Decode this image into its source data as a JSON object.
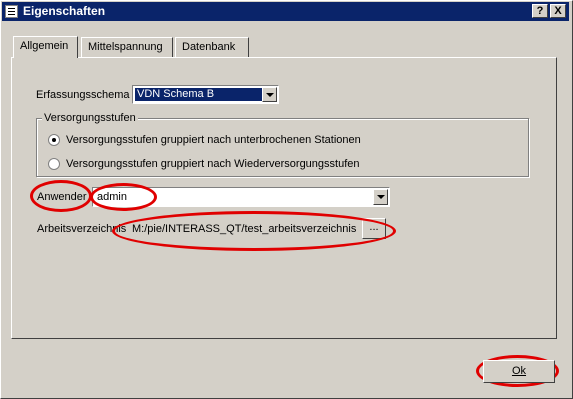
{
  "window": {
    "title": "Eigenschaften",
    "help_button": "?",
    "close_button": "X"
  },
  "tabs": [
    {
      "label": "Allgemein",
      "active": true
    },
    {
      "label": "Mittelspannung",
      "active": false
    },
    {
      "label": "Datenbank",
      "active": false
    }
  ],
  "form": {
    "erfassungsschema_label": "Erfassungsschema",
    "erfassungsschema_value": "VDN Schema B",
    "versorgungsstufen_group_title": "Versorgungsstufen",
    "radio_options": [
      {
        "label": "Versorgungsstufen gruppiert nach unterbrochenen Stationen",
        "checked": true
      },
      {
        "label": "Versorgungsstufen gruppiert nach Wiederversorgungsstufen",
        "checked": false
      }
    ],
    "anwender_label": "Anwender",
    "anwender_value": "admin",
    "arbeitsverzeichnis_label": "Arbeitsverzeichnis",
    "arbeitsverzeichnis_value": "M:/pie/INTERASS_QT/test_arbeitsverzeichnis",
    "browse_button": "..."
  },
  "footer": {
    "ok_label": "Ok"
  },
  "colors": {
    "titlebar": "#0a246a",
    "selection": "#0a246a",
    "annotation": "#e00000",
    "face": "#d4d0c8"
  }
}
